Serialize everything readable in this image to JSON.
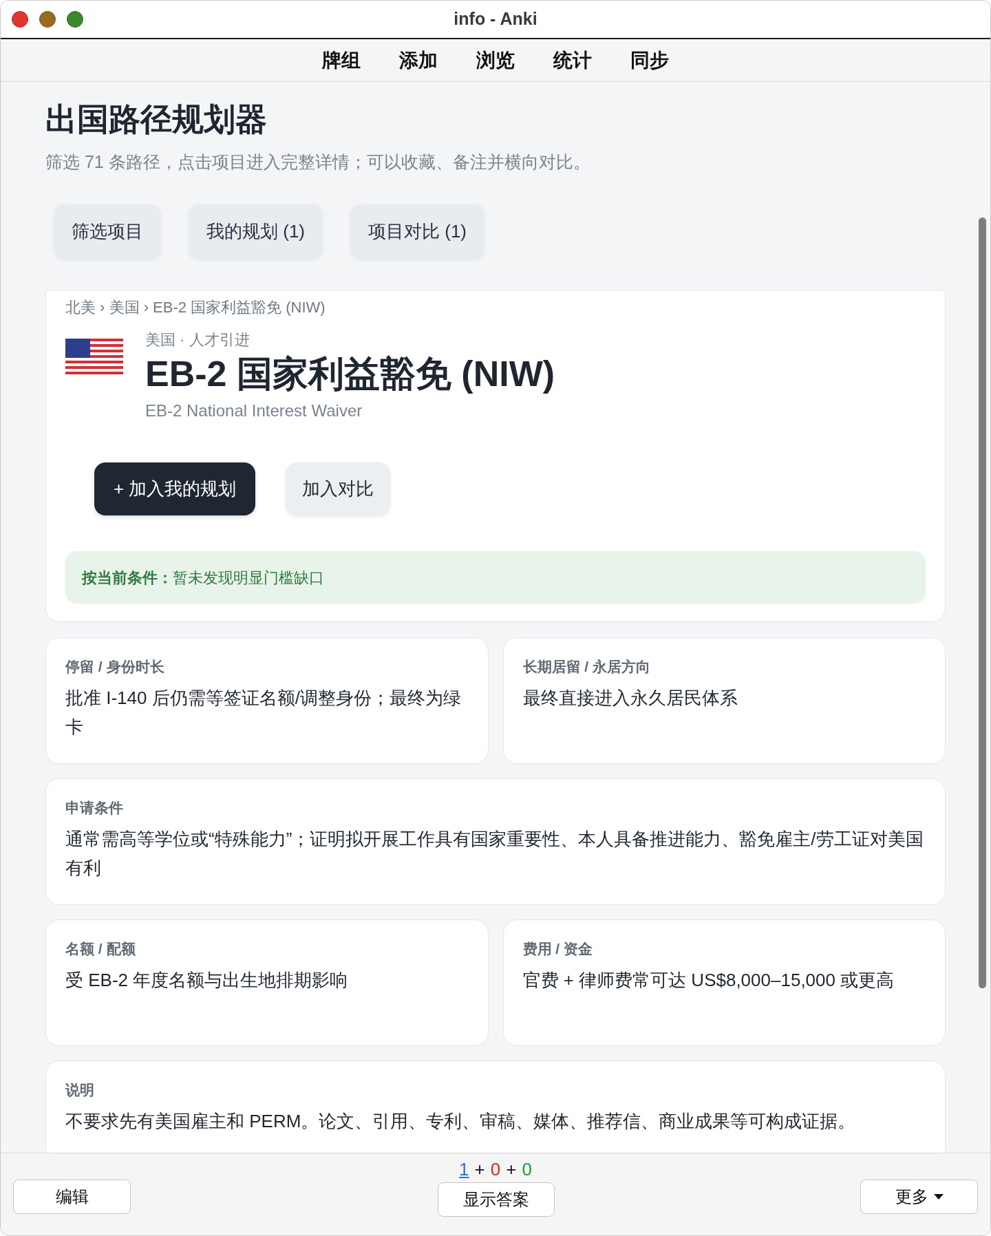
{
  "window": {
    "title": "info - Anki"
  },
  "toolbar": {
    "items": [
      "牌组",
      "添加",
      "浏览",
      "统计",
      "同步"
    ]
  },
  "page": {
    "title": "出国路径规划器",
    "subtitle": "筛选 71 条路径，点击项目进入完整详情；可以收藏、备注并横向对比。"
  },
  "tabs": [
    {
      "label": "筛选项目"
    },
    {
      "label": "我的规划 (1)"
    },
    {
      "label": "项目对比 (1)"
    }
  ],
  "detail": {
    "breadcrumb": "北美 › 美国 › EB-2 国家利益豁免 (NIW)",
    "meta": "美国 · 人才引进",
    "title": "EB-2 国家利益豁免 (NIW)",
    "english_title": "EB-2 National Interest Waiver",
    "buttons": [
      {
        "label": "+ 加入我的规划",
        "kind": "primary"
      },
      {
        "label": "加入对比",
        "kind": "secondary"
      }
    ],
    "status": {
      "label": "按当前条件：",
      "text": "暂未发现明显门槛缺口"
    }
  },
  "sections": [
    {
      "kind": "half",
      "label": "停留 / 身份时长",
      "text": "批准 I-140 后仍需等签证名额/调整身份；最终为绿卡"
    },
    {
      "kind": "half",
      "label": "长期居留 / 永居方向",
      "text": "最终直接进入永久居民体系"
    },
    {
      "kind": "full",
      "label": "申请条件",
      "text": "通常需高等学位或“特殊能力”；证明拟开展工作具有国家重要性、本人具备推进能力、豁免雇主/劳工证对美国有利"
    },
    {
      "kind": "half",
      "label": "名额 / 配额",
      "text": "受 EB-2 年度名额与出生地排期影响"
    },
    {
      "kind": "half",
      "label": "费用 / 资金",
      "text": "官费 + 律师费常可达 US$8,000–15,000 或更高"
    },
    {
      "kind": "full",
      "label": "说明",
      "text": "不要求先有美国雇主和 PERM。论文、引用、专利、审稿、媒体、推荐信、商业成果等可构成证据。"
    }
  ],
  "bottom": {
    "edit_button": "编辑",
    "counts": [
      {
        "kind": "count",
        "text": "1",
        "color": "#2f6fe0",
        "underlined": true
      },
      {
        "kind": "sep",
        "text": "+"
      },
      {
        "kind": "count",
        "text": "0",
        "color": "#e0201c",
        "underlined": false
      },
      {
        "kind": "sep",
        "text": "+"
      },
      {
        "kind": "count",
        "text": "0",
        "color": "#1a9e3a",
        "underlined": false
      }
    ],
    "show_answer_button": "显示答案",
    "more_button": "更多"
  }
}
